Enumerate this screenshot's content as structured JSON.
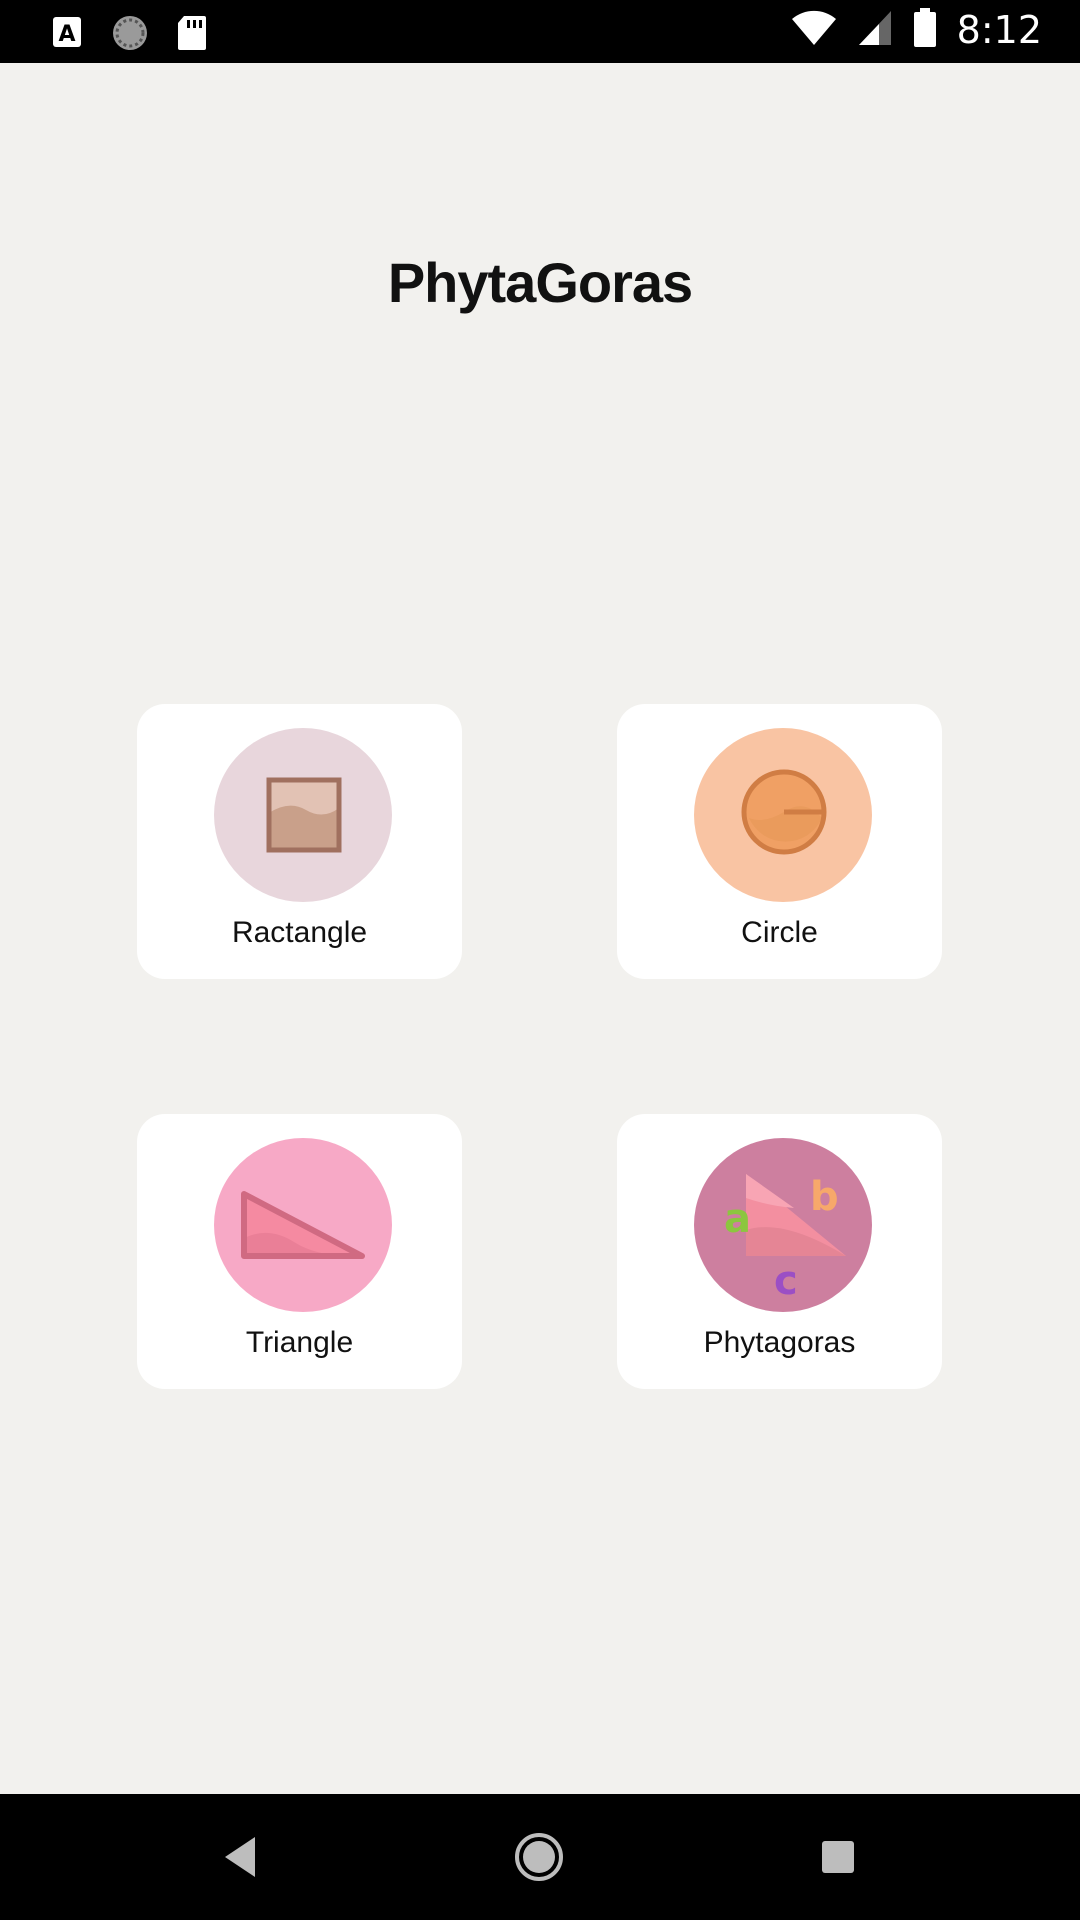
{
  "status_bar": {
    "time": "8:12",
    "icons": [
      "text-a-icon",
      "sync-icon",
      "sd-card-icon",
      "wifi-icon",
      "signal-icon",
      "battery-icon"
    ]
  },
  "app": {
    "title": "PhytaGoras"
  },
  "cards": [
    {
      "label": "Ractangle",
      "icon": "rectangle-icon",
      "color": "#e8d6dc"
    },
    {
      "label": "Circle",
      "icon": "circle-icon",
      "color": "#f9c4a3"
    },
    {
      "label": "Triangle",
      "icon": "triangle-icon",
      "color": "#f7a9c6"
    },
    {
      "label": "Phytagoras",
      "icon": "pythagoras-icon",
      "color": "#cd7f9f"
    }
  ],
  "nav_bar": {
    "icons": [
      "back-icon",
      "home-icon",
      "recents-icon"
    ]
  }
}
